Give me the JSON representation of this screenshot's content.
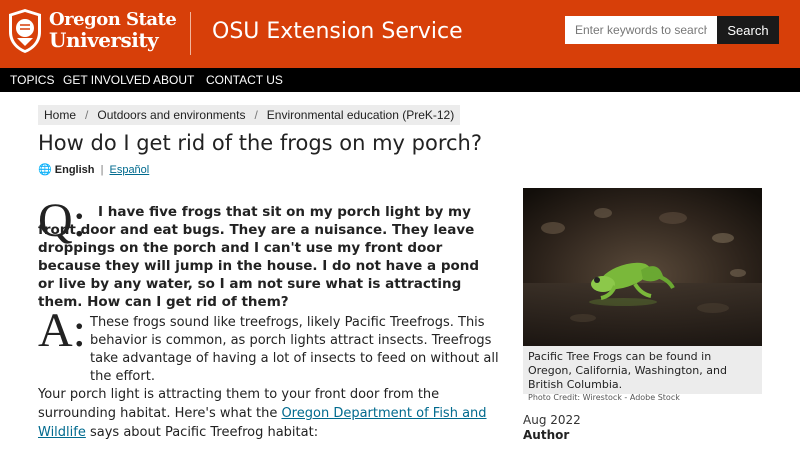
{
  "header": {
    "logo_line1": "Oregon State",
    "logo_line2": "University",
    "site_title": "OSU Extension Service",
    "search_placeholder": "Enter keywords to search...",
    "search_button": "Search",
    "brand_color": "#d73f09"
  },
  "nav": {
    "items": [
      "TOPICS",
      "GET INVOLVED",
      "ABOUT",
      "CONTACT US"
    ]
  },
  "breadcrumb": [
    "Home",
    "Outdoors and environments",
    "Environmental education (PreK-12)"
  ],
  "page": {
    "title": "How do I get rid of the frogs on my porch?",
    "lang_current": "English",
    "lang_sep": "|",
    "lang_alt": "Español",
    "q_letter": "Q:",
    "question": "I have five frogs that sit on my porch light by my front door and eat bugs. They are a nuisance. They leave droppings on the porch and I can't use my front door because they will jump in the house. I do not have a pond or live by any water, so I am not sure what is attracting them. How can I get rid of them?",
    "a_letter": "A:",
    "answer": "These frogs sound like treefrogs, likely Pacific Treefrogs. This behavior is common, as porch lights attract insects. Treefrogs take advantage of having a lot of insects to feed on without all the effort.",
    "body_before": "Your porch light is attracting them to your front door from the surrounding habitat. Here's what the ",
    "body_link": "Oregon Department of Fish and Wildlife",
    "body_after": " says about Pacific Treefrog habitat:"
  },
  "sidebar": {
    "caption": "Pacific Tree Frogs can be found in Oregon, California, Washington, and British Columbia.",
    "credit": "Photo Credit: Wirestock - Adobe Stock",
    "date": "Aug 2022",
    "author_label": "Author"
  },
  "icons": {
    "globe": "globe-icon",
    "seal": "osu-seal-icon"
  }
}
